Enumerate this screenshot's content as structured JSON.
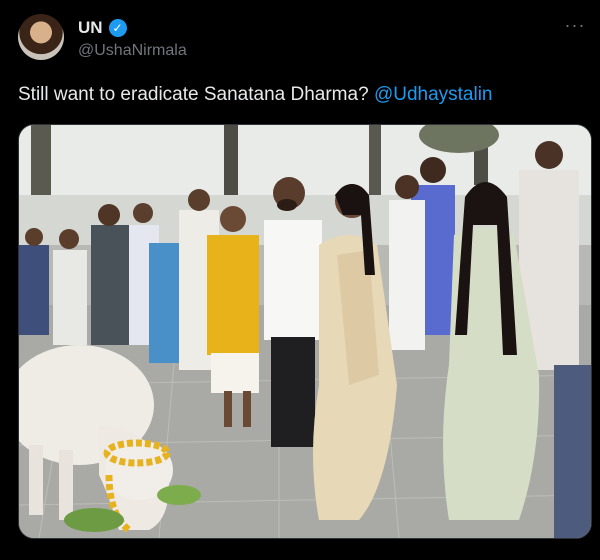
{
  "tweet": {
    "author_name": "UN",
    "handle": "@UshaNirmala",
    "text_before": "Still want to eradicate Sanatana Dharma? ",
    "mention": "@Udhaystalin",
    "more_label": "···",
    "verified_glyph": "✓"
  },
  "icons": {
    "verified": "verified-badge-icon",
    "more": "more-options-icon"
  },
  "colors": {
    "background": "#000000",
    "text": "#e7e9ea",
    "secondary_text": "#71767b",
    "accent": "#1d9bf0"
  }
}
